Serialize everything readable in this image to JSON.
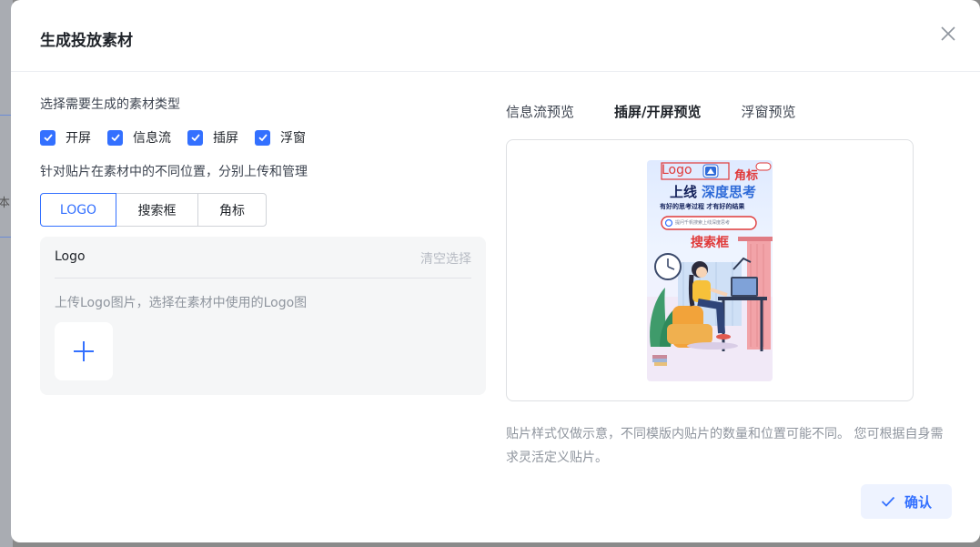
{
  "backdrop": {
    "visible_char": "本"
  },
  "dialog": {
    "title": "生成投放素材",
    "type_section_label": "选择需要生成的素材类型",
    "material_types": [
      {
        "label": "开屏",
        "checked": true
      },
      {
        "label": "信息流",
        "checked": true
      },
      {
        "label": "插屏",
        "checked": true
      },
      {
        "label": "浮窗",
        "checked": true
      }
    ],
    "position_section_label": "针对贴片在素材中的不同位置，分别上传和管理",
    "segments": [
      {
        "label": "LOGO",
        "active": true
      },
      {
        "label": "搜索框",
        "active": false
      },
      {
        "label": "角标",
        "active": false
      }
    ],
    "upload_panel": {
      "title": "Logo",
      "clear_label": "清空选择",
      "hint": "上传Logo图片，选择在素材中使用的Logo图"
    },
    "preview_tabs": [
      {
        "label": "信息流预览",
        "active": false
      },
      {
        "label": "插屏/开屏预览",
        "active": true
      },
      {
        "label": "浮窗预览",
        "active": false
      }
    ],
    "poster": {
      "logo_label": "Logo",
      "corner_label": "角标",
      "headline_a": "上线",
      "headline_b": "深度思考",
      "subline": "有好的思考过程 才有好的结果",
      "search_placeholder": "提问千帆搜索上线深度思考",
      "search_label": "搜索框"
    },
    "note": "贴片样式仅做示意，不同模版内贴片的数量和位置可能不同。 您可根据自身需求灵活定义贴片。",
    "confirm_label": "确认"
  },
  "colors": {
    "accent": "#3370ff",
    "annotation_red": "#e03a3a"
  }
}
